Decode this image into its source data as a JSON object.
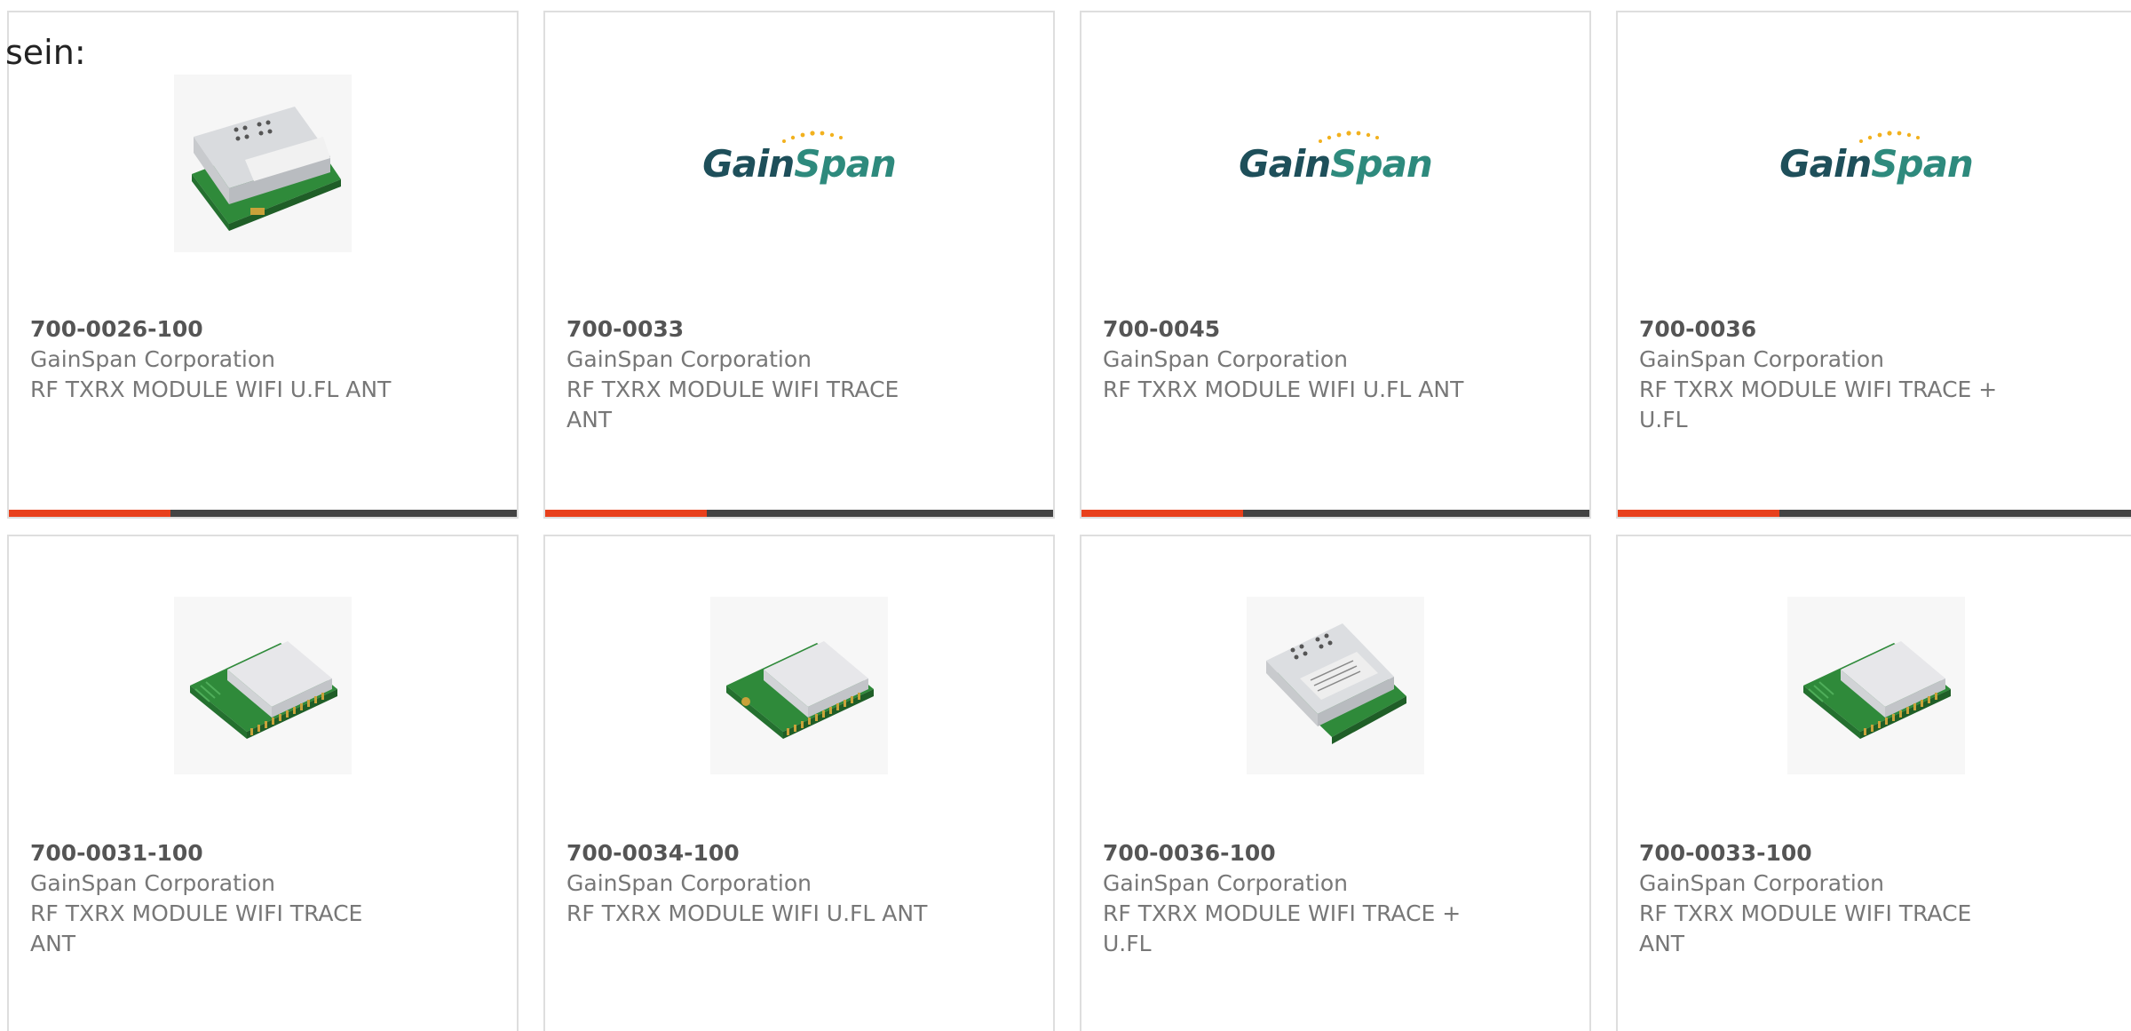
{
  "heading": "sein:",
  "colors": {
    "accent": "#e8401c",
    "bar": "#444444",
    "logo_dark": "#1e4f5a",
    "logo_teal": "#2e8a7d",
    "logo_dots": "#f2b11e"
  },
  "logo": {
    "word_a": "Gain",
    "word_b": "Span"
  },
  "products": [
    {
      "part": "700-0026-100",
      "manufacturer": "GainSpan Corporation",
      "desc_line1": "RF TXRX MODULE WIFI U.FL ANT",
      "desc_line2": "",
      "image": "module-shielded-photo"
    },
    {
      "part": "700-0033",
      "manufacturer": "GainSpan Corporation",
      "desc_line1": "RF TXRX MODULE WIFI TRACE",
      "desc_line2": "ANT",
      "image": "gainspan-logo"
    },
    {
      "part": "700-0045",
      "manufacturer": "GainSpan Corporation",
      "desc_line1": "RF TXRX MODULE WIFI U.FL ANT",
      "desc_line2": "",
      "image": "gainspan-logo"
    },
    {
      "part": "700-0036",
      "manufacturer": "GainSpan Corporation",
      "desc_line1": "RF TXRX MODULE WIFI TRACE +",
      "desc_line2": "U.FL",
      "image": "gainspan-logo"
    },
    {
      "part": "700-0031-100",
      "manufacturer": "GainSpan Corporation",
      "desc_line1": "RF TXRX MODULE WIFI TRACE",
      "desc_line2": "ANT",
      "image": "module-photo"
    },
    {
      "part": "700-0034-100",
      "manufacturer": "GainSpan Corporation",
      "desc_line1": "RF TXRX MODULE WIFI U.FL ANT",
      "desc_line2": "",
      "image": "module-photo"
    },
    {
      "part": "700-0036-100",
      "manufacturer": "GainSpan Corporation",
      "desc_line1": "RF TXRX MODULE WIFI TRACE +",
      "desc_line2": "U.FL",
      "image": "module-labeled-photo"
    },
    {
      "part": "700-0033-100",
      "manufacturer": "GainSpan Corporation",
      "desc_line1": "RF TXRX MODULE WIFI TRACE",
      "desc_line2": "ANT",
      "image": "module-photo"
    }
  ]
}
